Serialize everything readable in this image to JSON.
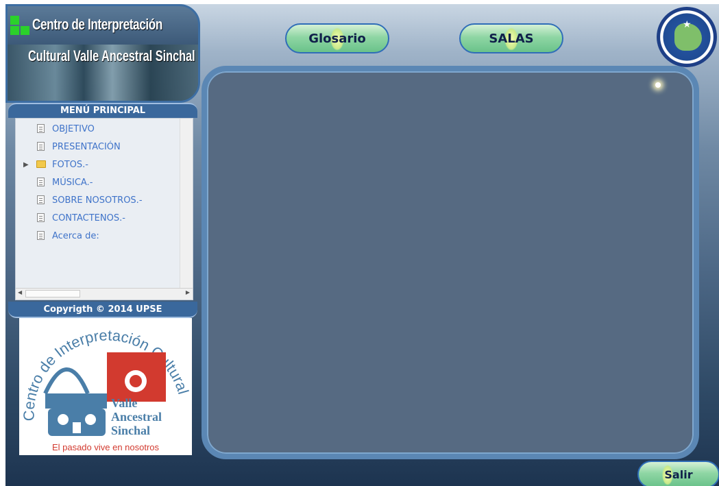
{
  "header": {
    "title_line1": "Centro de Interpretación",
    "title_line2": "Cultural Valle Ancestral Sinchal"
  },
  "top_nav": {
    "glosario_label": "Glosario",
    "salas_label": "SALAS"
  },
  "menu": {
    "heading": "MENÚ PRINCIPAL",
    "items": [
      {
        "label": "OBJETIVO",
        "icon": "document-icon"
      },
      {
        "label": "PRESENTACIÓN",
        "icon": "document-icon"
      },
      {
        "label": "FOTOS.-",
        "icon": "folder-icon",
        "expandable": true
      },
      {
        "label": "MÚSICA.-",
        "icon": "document-icon"
      },
      {
        "label": "SOBRE NOSOTROS.-",
        "icon": "document-icon"
      },
      {
        "label": "CONTACTENOS.-",
        "icon": "document-icon"
      },
      {
        "label": "Acerca de:",
        "icon": "document-icon"
      }
    ]
  },
  "copyright": "Copyrigth © 2014 UPSE",
  "logo": {
    "arc_text": "Centro de Interpretación Cultural",
    "line1": "Valle",
    "line2": "Ancestral",
    "line3": "Sinchal",
    "slogan": "El pasado vive en nosotros"
  },
  "exit_label": "Salir",
  "colors": {
    "accent_green": "#2bd12b",
    "menu_link": "#3f73c9",
    "logo_red": "#d23a2f",
    "logo_blue": "#4a7ea8"
  }
}
